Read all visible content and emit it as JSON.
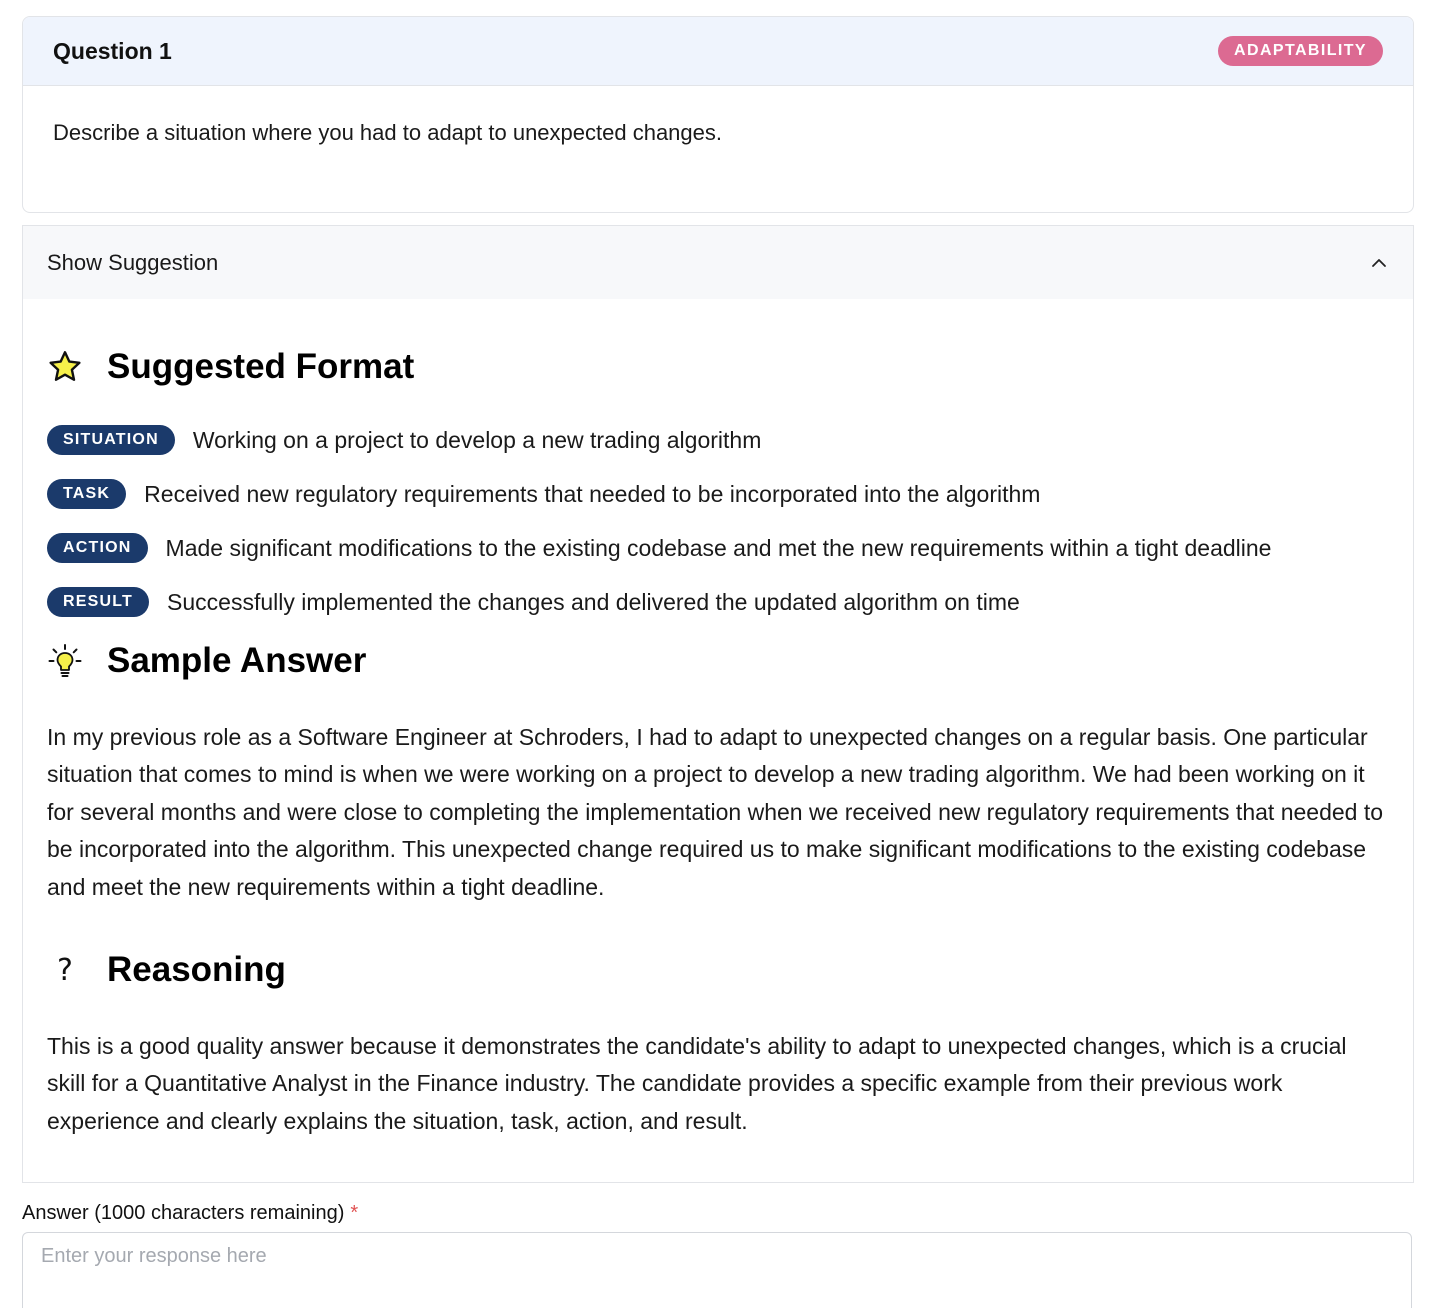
{
  "question": {
    "title": "Question 1",
    "category": "ADAPTABILITY",
    "text": "Describe a situation where you had to adapt to unexpected changes."
  },
  "suggestion": {
    "toggle_label": "Show Suggestion",
    "format_heading": "Suggested Format",
    "star": [
      {
        "tag": "SITUATION",
        "text": "Working on a project to develop a new trading algorithm"
      },
      {
        "tag": "TASK",
        "text": "Received new regulatory requirements that needed to be incorporated into the algorithm"
      },
      {
        "tag": "ACTION",
        "text": "Made significant modifications to the existing codebase and met the new requirements within a tight deadline"
      },
      {
        "tag": "RESULT",
        "text": "Successfully implemented the changes and delivered the updated algorithm on time"
      }
    ],
    "sample_heading": "Sample Answer",
    "sample_answer": "In my previous role as a Software Engineer at Schroders, I had to adapt to unexpected changes on a regular basis. One particular situation that comes to mind is when we were working on a project to develop a new trading algorithm. We had been working on it for several months and were close to completing the implementation when we received new regulatory requirements that needed to be incorporated into the algorithm. This unexpected change required us to make significant modifications to the existing codebase and meet the new requirements within a tight deadline.",
    "reasoning_heading": "Reasoning",
    "reasoning_icon_glyph": "?",
    "reasoning": "This is a good quality answer because it demonstrates the candidate's ability to adapt to unexpected changes, which is a crucial skill for a Quantitative Analyst in the Finance industry. The candidate provides a specific example from their previous work experience and clearly explains the situation, task, action, and result."
  },
  "answer": {
    "label": "Answer (1000 characters remaining)",
    "required_mark": "*",
    "placeholder": "Enter your response here",
    "value": ""
  },
  "icons": {
    "format": "star-icon",
    "sample": "lightbulb-icon",
    "reasoning": "question-mark-icon",
    "toggle": "chevron-up-icon"
  },
  "colors": {
    "category_badge": "#dc6a92",
    "star_tag": "#1b3a6b",
    "header_bg": "#eff4fd",
    "star_icon_fill": "#f6f04a",
    "required": "#e05252"
  }
}
